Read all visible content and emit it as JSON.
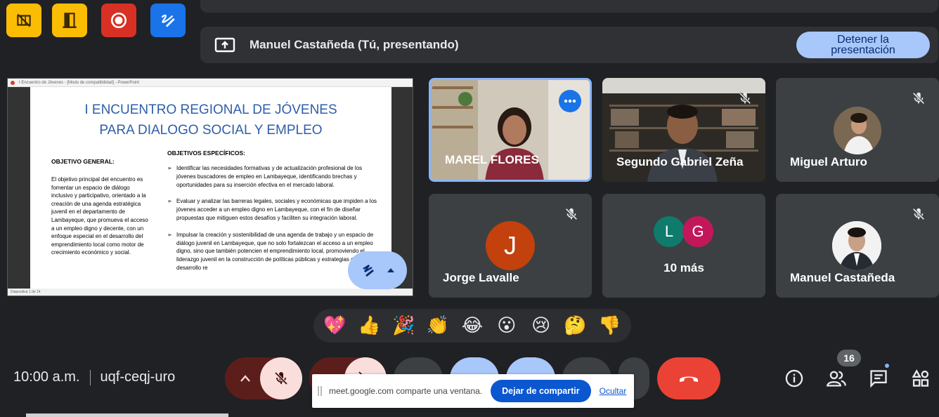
{
  "presentation_bar": {
    "presenter_text": "Manuel Castañeda (Tú, presentando)",
    "stop_button": "Detener la presentación"
  },
  "slide": {
    "window_title": "I Encuentro de Jóvenes - [Modo de compatibilidad] - PowerPoint",
    "title_line1": "I ENCUENTRO REGIONAL DE JÓVENES",
    "title_line2": "PARA DIALOGO SOCIAL Y EMPLEO",
    "general_heading": "OBJETIVO GENERAL:",
    "general_text": "El objetivo principal del encuentro es fomentar un espacio de diálogo inclusivo y participativo, orientado a la creación de una agenda estratégica juvenil en el departamento de Lambayeque, que promueva el acceso a un empleo digno y decente, con un enfoque especial en el desarrollo del emprendimiento local como motor de crecimiento económico y social.",
    "specific_heading": "OBJETIVOS ESPECÍFICOS:",
    "specific_items": [
      "Identificar las necesidades formativas y de actualización profesional de los jóvenes buscadores de empleo en Lambayeque, identificando brechas y oportunidades para su inserción efectiva en el mercado laboral.",
      "Evaluar y analizar las barreras legales, sociales y económicas que impiden a los jóvenes acceder a un empleo digno en Lambayeque, con el fin de diseñar propuestas que mitiguen estos desafíos y faciliten su integración laboral.",
      "Impulsar la creación y sostenibilidad de una agenda de trabajo y un espacio de diálogo juvenil en Lambayeque, que no solo fortalezcan el acceso a un empleo digno, sino que también potencien el emprendimiento local, promoviendo el liderazgo juvenil en la construcción de políticas públicas y estrategias de desarrollo re"
    ],
    "status": "Diapositiva 1 de 14"
  },
  "participants": [
    {
      "name": "MAREL FLORES"
    },
    {
      "name": "Segundo Gabriel Zeña"
    },
    {
      "name": "Miguel Arturo"
    },
    {
      "name": "Jorge Lavalle",
      "initial": "J"
    },
    {
      "name": "10 más",
      "initials": [
        "L",
        "G"
      ]
    },
    {
      "name": "Manuel Castañeda"
    }
  ],
  "reactions": [
    "💖",
    "👍",
    "🎉",
    "👏",
    "😂",
    "😮",
    "😢",
    "🤔",
    "👎"
  ],
  "bottom_bar": {
    "time": "10:00 a.m.",
    "meeting_code": "uqf-ceqj-uro",
    "people_count": "16"
  },
  "share_notice": {
    "message": "meet.google.com comparte una ventana.",
    "stop_sharing": "Dejar de compartir",
    "hide": "Ocultar"
  },
  "icons": {
    "tool1": "no-camera-grid-icon",
    "tool2": "door-icon",
    "tool3": "record-icon",
    "tool4": "whiteboard-pen-icon",
    "present": "present-screen-icon",
    "mic_off": "mic-off-icon",
    "more": "more-dots-icon",
    "end_call": "end-call-icon",
    "info": "info-icon",
    "people": "people-icon",
    "chat": "chat-icon",
    "activities": "activities-icon"
  },
  "colors": {
    "background": "#202124",
    "tile": "#3c4043",
    "accent_blue": "#a8c7fa",
    "end_call_red": "#ea4335",
    "tool_yellow": "#fbbc04",
    "tool_red": "#d93025",
    "tool_blue": "#1a73e8"
  }
}
